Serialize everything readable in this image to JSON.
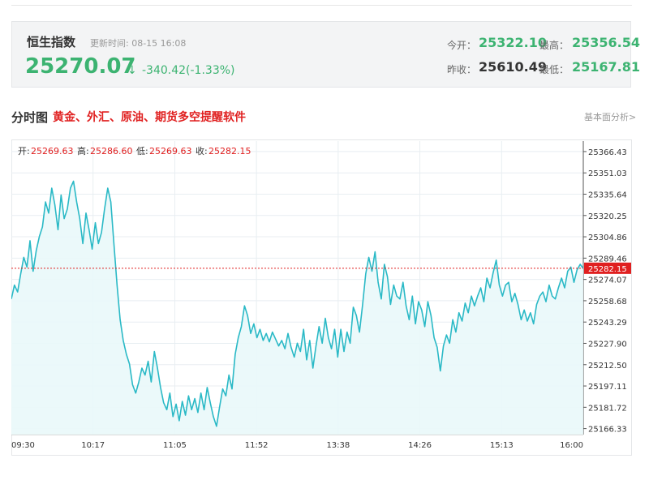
{
  "quote": {
    "name": "恒生指数",
    "update_label": "更新时间:",
    "update_time": "08-15 16:08",
    "price": "25270.07",
    "arrow": "↓",
    "change": "-340.42(-1.33%)",
    "open_label": "今开：",
    "open": "25322.10",
    "high_label": "最高：",
    "high": "25356.54",
    "prev_close_label": "昨收：",
    "prev_close": "25610.49",
    "low_label": "最低：",
    "low": "25167.81"
  },
  "section": {
    "title": "分时图",
    "promo_link": "黄金、外汇、原油、期货多空提醒软件",
    "right_link": "基本面分析>"
  },
  "chart_data": {
    "type": "area",
    "ohlc_bar": [
      {
        "label": "开:",
        "value": "25269.63"
      },
      {
        "label": "高:",
        "value": "25286.60"
      },
      {
        "label": "低:",
        "value": "25269.63"
      },
      {
        "label": "收:",
        "value": "25282.15"
      }
    ],
    "x_ticks": [
      "09:30",
      "10:17",
      "11:05",
      "11:52",
      "13:38",
      "14:26",
      "15:13",
      "16:00"
    ],
    "y_ticks": [
      25366.43,
      25351.03,
      25335.64,
      25320.25,
      25304.86,
      25289.46,
      25274.07,
      25258.68,
      25243.29,
      25227.9,
      25212.5,
      25197.11,
      25181.72,
      25166.33
    ],
    "ylim": [
      25162,
      25374
    ],
    "current_price_label": "25282.15",
    "current_price": 25282.15,
    "colors": {
      "line": "#2ab9c6",
      "fill": "#e9f8fa",
      "marker": "#e02020",
      "grid": "#e8eef2"
    },
    "values": [
      25260,
      25270,
      25265,
      25278,
      25290,
      25283,
      25302,
      25280,
      25295,
      25305,
      25312,
      25330,
      25322,
      25340,
      25328,
      25310,
      25335,
      25318,
      25325,
      25340,
      25345,
      25330,
      25318,
      25300,
      25322,
      25310,
      25296,
      25315,
      25300,
      25308,
      25325,
      25340,
      25330,
      25300,
      25270,
      25245,
      25230,
      25220,
      25213,
      25198,
      25192,
      25200,
      25210,
      25205,
      25215,
      25200,
      25222,
      25210,
      25196,
      25185,
      25180,
      25192,
      25175,
      25184,
      25172,
      25186,
      25176,
      25190,
      25180,
      25188,
      25178,
      25192,
      25180,
      25196,
      25185,
      25175,
      25168,
      25182,
      25195,
      25190,
      25205,
      25195,
      25220,
      25232,
      25240,
      25255,
      25248,
      25235,
      25242,
      25232,
      25238,
      25230,
      25235,
      25229,
      25236,
      25231,
      25226,
      25230,
      25224,
      25235,
      25225,
      25218,
      25228,
      25222,
      25238,
      25216,
      25230,
      25210,
      25226,
      25240,
      25228,
      25246,
      25232,
      25224,
      25238,
      25218,
      25238,
      25222,
      25236,
      25228,
      25254,
      25248,
      25236,
      25256,
      25278,
      25290,
      25280,
      25294,
      25272,
      25260,
      25285,
      25276,
      25256,
      25270,
      25262,
      25260,
      25272,
      25255,
      25245,
      25262,
      25242,
      25258,
      25252,
      25240,
      25258,
      25248,
      25232,
      25225,
      25208,
      25226,
      25234,
      25228,
      25245,
      25236,
      25250,
      25244,
      25257,
      25250,
      25262,
      25255,
      25262,
      25268,
      25258,
      25275,
      25268,
      25279,
      25288,
      25270,
      25262,
      25270,
      25272,
      25258,
      25264,
      25256,
      25245,
      25252,
      25244,
      25250,
      25242,
      25256,
      25262,
      25265,
      25258,
      25270,
      25262,
      25260,
      25268,
      25275,
      25268,
      25280,
      25283,
      25272,
      25281,
      25285,
      25282
    ]
  }
}
